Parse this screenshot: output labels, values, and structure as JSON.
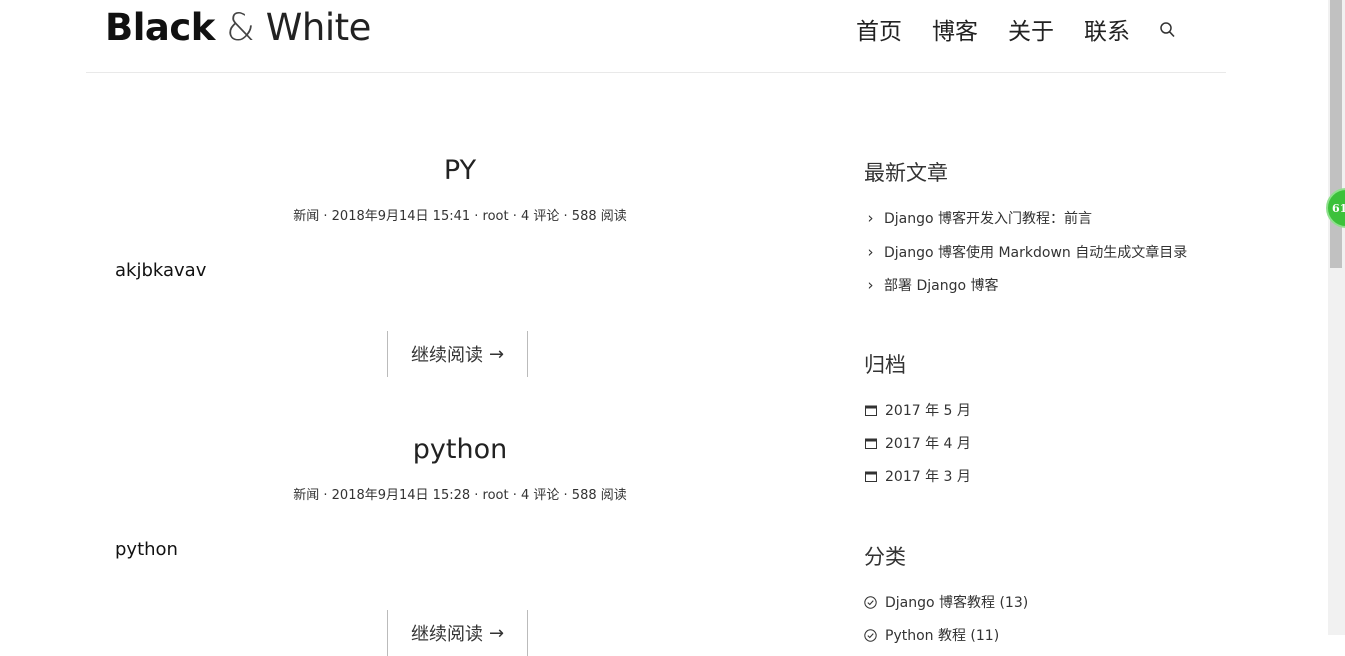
{
  "header": {
    "logo_part1": "Black",
    "logo_amp": "&",
    "logo_part2": "White",
    "nav": [
      "首页",
      "博客",
      "关于",
      "联系"
    ]
  },
  "posts": [
    {
      "title": "PY",
      "meta": "新闻 · 2018年9月14日 15:41 · root · 4 评论 · 588 阅读",
      "excerpt": "akjbkavav",
      "read_more": "继续阅读",
      "arrow": "→"
    },
    {
      "title": "python",
      "meta": "新闻 · 2018年9月14日 15:28 · root · 4 评论 · 588 阅读",
      "excerpt": "python",
      "read_more": "继续阅读",
      "arrow": "→"
    }
  ],
  "sidebar": {
    "recent": {
      "title": "最新文章",
      "items": [
        "Django 博客开发入门教程：前言",
        "Django 博客使用 Markdown 自动生成文章目录",
        "部署 Django 博客"
      ]
    },
    "archive": {
      "title": "归档",
      "items": [
        "2017 年 5 月",
        "2017 年 4 月",
        "2017 年 3 月"
      ]
    },
    "category": {
      "title": "分类",
      "items": [
        "Django 博客教程 (13)",
        "Python 教程 (11)"
      ]
    }
  },
  "badge": {
    "text": "61"
  },
  "icons": {
    "search": "search-icon",
    "chevron": "chevron-right-icon",
    "calendar": "calendar-icon",
    "check": "check-circle-icon"
  }
}
